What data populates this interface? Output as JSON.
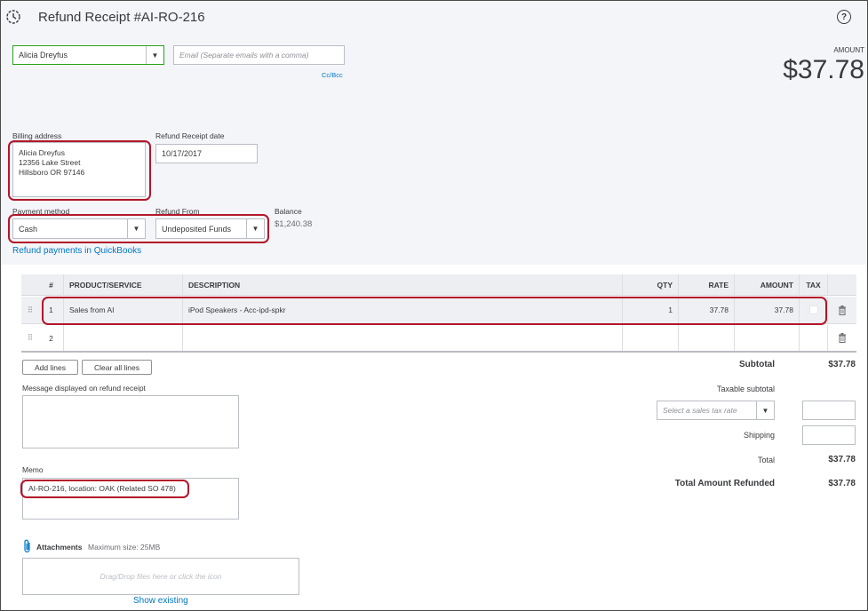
{
  "header": {
    "title": "Refund Receipt #AI-RO-216",
    "amount_label": "AMOUNT",
    "amount_value": "$37.78"
  },
  "customer": {
    "value": "Alicia Dreyfus",
    "email_placeholder": "Email (Separate emails with a comma)",
    "cc_bcc": "Cc/Bcc"
  },
  "billing": {
    "label": "Billing address",
    "lines": [
      "Alicia Dreyfus",
      "12356 Lake Street",
      "Hillsboro OR 97146"
    ]
  },
  "receipt_date": {
    "label": "Refund Receipt date",
    "value": "10/17/2017"
  },
  "payment": {
    "method_label": "Payment method",
    "method_value": "Cash",
    "from_label": "Refund From",
    "from_value": "Undeposited Funds",
    "balance_label": "Balance",
    "balance_value": "$1,240.38",
    "qb_link": "Refund payments in QuickBooks"
  },
  "table": {
    "headers": [
      "#",
      "PRODUCT/SERVICE",
      "DESCRIPTION",
      "QTY",
      "RATE",
      "AMOUNT",
      "TAX"
    ],
    "rows": [
      {
        "num": "1",
        "product": "Sales from AI",
        "description": "iPod Speakers  - Acc-ipd-spkr",
        "qty": "1",
        "rate": "37.78",
        "amount": "37.78"
      },
      {
        "num": "2",
        "product": "",
        "description": "",
        "qty": "",
        "rate": "",
        "amount": ""
      }
    ]
  },
  "buttons": {
    "add_lines": "Add lines",
    "clear_lines": "Clear all lines"
  },
  "message": {
    "label": "Message displayed on refund receipt"
  },
  "memo": {
    "label": "Memo",
    "value": "AI-RO-216, location: OAK (Related SO 478)"
  },
  "attachments": {
    "label": "Attachments",
    "max_size": "Maximum size: 25MB",
    "drop_text": "Drag/Drop files here or click the icon",
    "show_existing": "Show existing"
  },
  "totals": {
    "subtotal_label": "Subtotal",
    "subtotal_value": "$37.78",
    "taxable_label": "Taxable subtotal",
    "tax_rate_placeholder": "Select a sales tax rate",
    "shipping_label": "Shipping",
    "total_label": "Total",
    "total_value": "$37.78",
    "refunded_label": "Total Amount Refunded",
    "refunded_value": "$37.78"
  },
  "icons": {
    "history": "history-icon",
    "help": "help-icon",
    "paperclip": "paperclip-icon",
    "trash": "trash-icon",
    "drag": "drag-handle-icon"
  }
}
